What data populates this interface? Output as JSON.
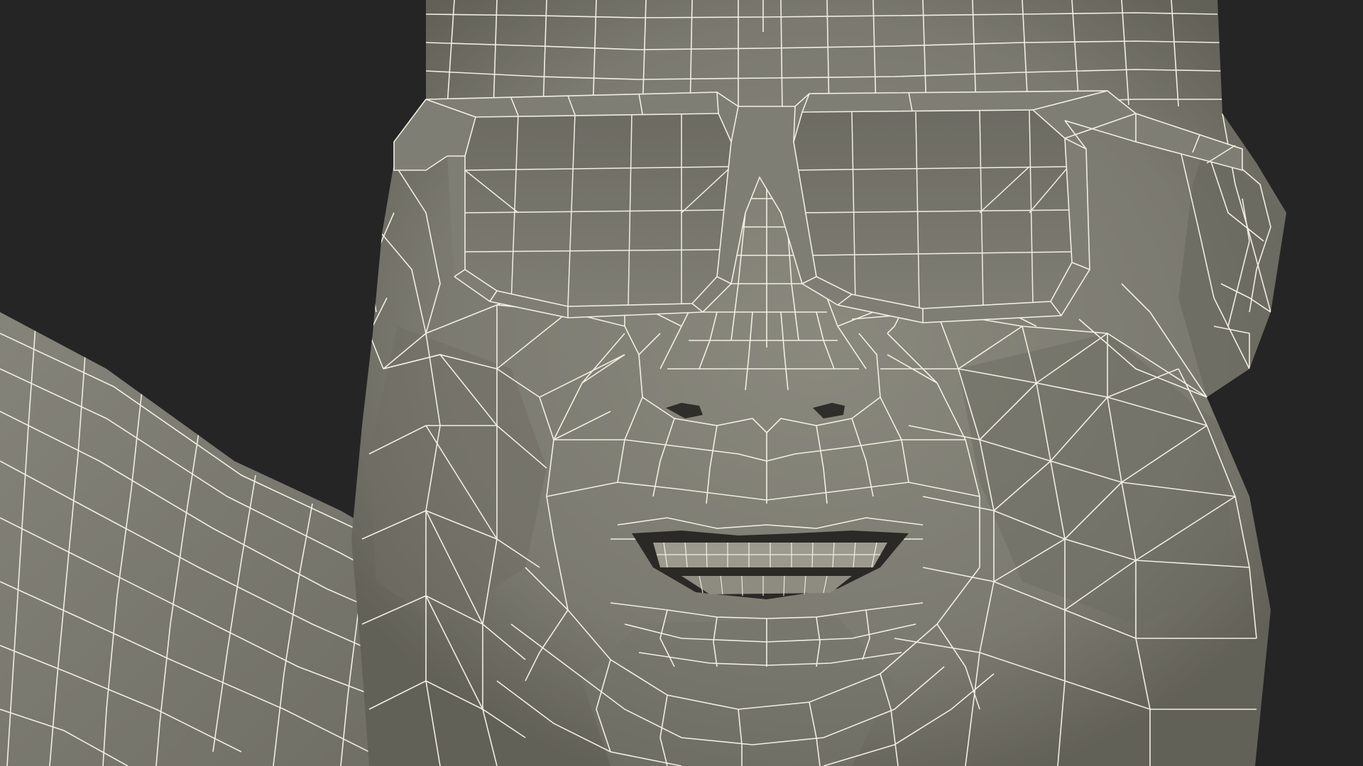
{
  "scene": {
    "subject": "wireframe-head-with-sunglasses",
    "render_mode": "shaded-wireframe",
    "colors": {
      "background": "#252525",
      "mesh_surface": "#7e7d72",
      "mesh_shadow": "#5f5e55",
      "mesh_highlight": "#8d8c81",
      "wire": "#f1efe2",
      "cavity": "#2a2926"
    }
  }
}
